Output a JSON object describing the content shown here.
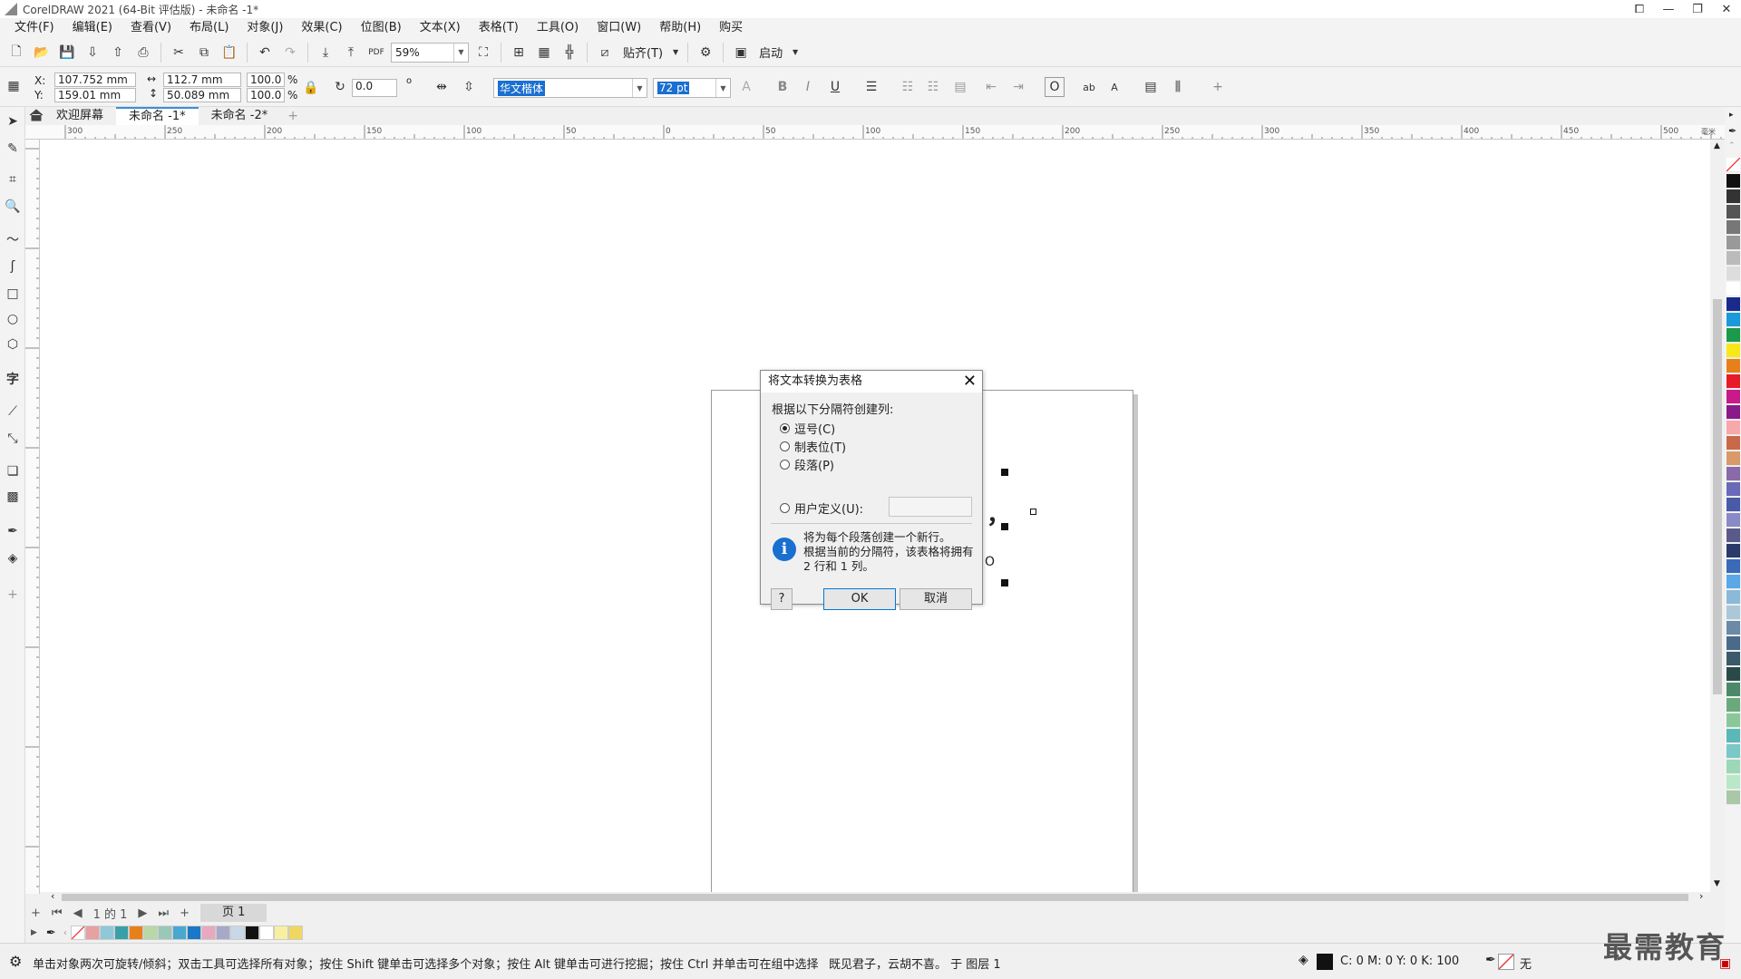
{
  "window": {
    "title": "CorelDRAW 2021 (64-Bit 评估版) - 未命名 -1*"
  },
  "menu": [
    "文件(F)",
    "编辑(E)",
    "查看(V)",
    "布局(L)",
    "对象(J)",
    "效果(C)",
    "位图(B)",
    "文本(X)",
    "表格(T)",
    "工具(O)",
    "窗口(W)",
    "帮助(H)",
    "购买"
  ],
  "toolbar": {
    "zoom": "59%",
    "snap_label": "贴齐(T)",
    "launch_label": "启动"
  },
  "propbar": {
    "x_label": "X:",
    "x_value": "107.752 mm",
    "y_label": "Y:",
    "y_value": "159.01 mm",
    "w_value": "112.7 mm",
    "h_value": "50.089 mm",
    "sx_value": "100.0",
    "sy_value": "100.0",
    "percent": "%",
    "angle_value": "0.0",
    "degree": "o",
    "font_name": "华文楷体",
    "font_size": "72 pt",
    "bold": "B",
    "italic": "I",
    "underline": "U"
  },
  "tabs": [
    {
      "label": "欢迎屏幕",
      "active": false
    },
    {
      "label": "未命名 -1*",
      "active": true
    },
    {
      "label": "未命名 -2*",
      "active": false
    }
  ],
  "ruler_h_ticks": [
    "300",
    "250",
    "200",
    "150",
    "100",
    "50",
    "0",
    "50",
    "100",
    "150",
    "200",
    "250",
    "300",
    "350",
    "400",
    "450",
    "500"
  ],
  "ruler_unit": "毫米",
  "dialog": {
    "title": "将文本转换为表格",
    "prompt": "根据以下分隔符创建列:",
    "options": [
      {
        "label": "逗号(C)",
        "checked": true
      },
      {
        "label": "制表位(T)",
        "checked": false
      },
      {
        "label": "段落(P)",
        "checked": false
      },
      {
        "label": "用户定义(U):",
        "checked": false
      }
    ],
    "info_line1": "将为每个段落创建一个新行。",
    "info_line2": "根据当前的分隔符，该表格将拥有 2 行和 1 列。",
    "help_label": "?",
    "ok_label": "OK",
    "cancel_label": "取消"
  },
  "canvas_text": {
    "comma": "，",
    "circle": "O"
  },
  "pagenav": {
    "page_info": "1 的 1",
    "page_tab": "页 1"
  },
  "status": {
    "hint": "单击对象两次可旋转/倾斜；双击工具可选择所有对象；按住 Shift 键单击可选择多个对象；按住 Alt 键单击可进行挖掘；按住 Ctrl 并单击可在组中选择",
    "layer": "既见君子，云胡不喜。 于 图层 1",
    "fill_cmyk": "C: 0 M: 0 Y: 0 K: 100",
    "outline": "无"
  },
  "watermark": "最需教育",
  "colors": {
    "accent": "#3a8fd8",
    "info": "#1a6fd0",
    "palette_bottom": [
      "#e8a0a0",
      "#8fc8d8",
      "#3aa0a8",
      "#e8801a",
      "#b8d8a8",
      "#9ac8b8",
      "#48a8d0",
      "#1a78c8",
      "#e8a8c0",
      "#a8a8c8",
      "#c8d8e8",
      "#111111",
      "#ffffff",
      "#f8f0a0",
      "#f0d860"
    ],
    "palette_right": [
      "#111111",
      "#333333",
      "#555555",
      "#777777",
      "#999999",
      "#bbbbbb",
      "#dddddd",
      "#ffffff",
      "#1a2a8a",
      "#1a9ad8",
      "#1a9a4a",
      "#f8e81a",
      "#e8801a",
      "#e81a2a",
      "#c81a8a",
      "#8a1a8a",
      "#f8a8a8",
      "#c86a4a",
      "#d89a6a",
      "#8a6aa8",
      "#6a6ab8",
      "#4a5aa8",
      "#8a8ac8",
      "#5a5a8a",
      "#2a3a6a",
      "#3a6ab8",
      "#5aa8e8",
      "#8abad8",
      "#aac8d8",
      "#6a8aa8",
      "#4a6a8a",
      "#3a5a6a",
      "#2a4a4a",
      "#4a8a6a",
      "#6aaa7a",
      "#8ac89a",
      "#5ab8b8",
      "#7ac8c8",
      "#9ad8b8",
      "#b8e8c8",
      "#a8c8a8"
    ]
  }
}
